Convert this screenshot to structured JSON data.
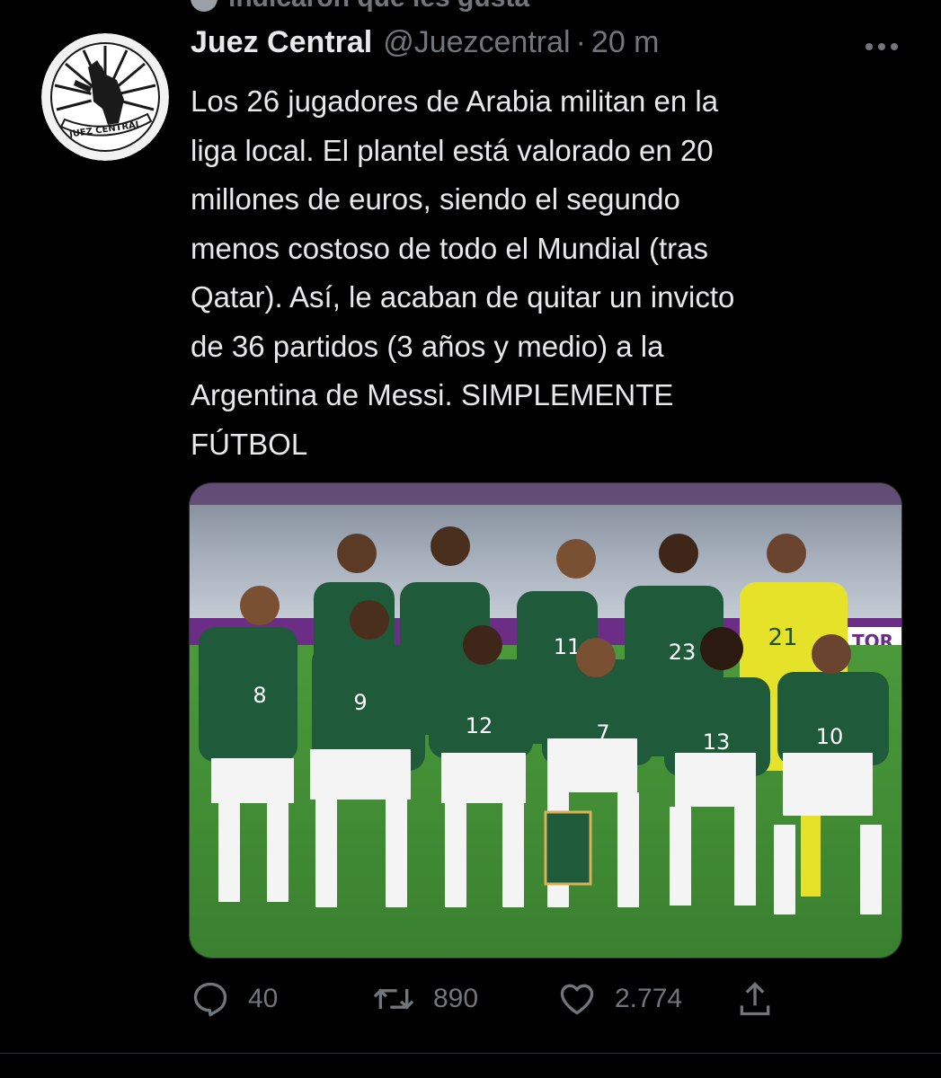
{
  "social_context": {
    "label": "indicaron que les gusta",
    "icon": "heart-user-icon"
  },
  "author": {
    "display_name": "Juez Central",
    "handle": "@Juezcentral",
    "separator": "·",
    "time": "20 m",
    "avatar_label": "JUEZ CENTRAL"
  },
  "tweet": {
    "text": "Los 26 jugadores de Arabia militan en la\nliga local. El plantel está valorado en 20\nmillones de euros, siendo el segundo\nmenos costoso de todo el Mundial (tras\nQatar).  Así, le acaban de quitar un invicto\nde 36 partidos (3 años y medio) a la\nArgentina de Messi. SIMPLEMENTE\nFÚTBOL"
  },
  "media": {
    "banner_text": "TOR",
    "jersey_numbers": [
      "8",
      "9",
      "12",
      "7",
      "13",
      "10",
      "11",
      "23",
      "21"
    ]
  },
  "actions": {
    "reply_count": "40",
    "retweet_count": "890",
    "like_count": "2.774"
  },
  "colors": {
    "background": "#000000",
    "text_primary": "#e7e9ea",
    "text_secondary": "#71767b",
    "jersey_green": "#1f5a3a",
    "goalkeeper_yellow": "#e6e22a"
  }
}
